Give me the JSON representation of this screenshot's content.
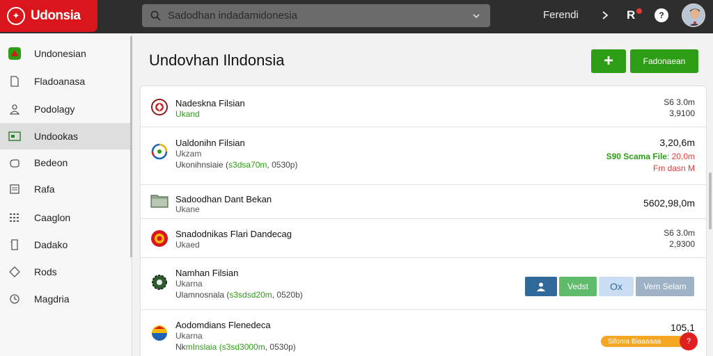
{
  "app": {
    "brand": "Udonsia",
    "search_placeholder": "Sadodhan indadamidonesia"
  },
  "topbar": {
    "link_label": "Ferendi",
    "notif_label": "R",
    "help_label": "?"
  },
  "sidebar": {
    "items": [
      {
        "label": "Undonesian",
        "icon": "app-logo-icon"
      },
      {
        "label": "Fladoanasa",
        "icon": "file-icon"
      },
      {
        "label": "Podolagy",
        "icon": "user-icon"
      },
      {
        "label": "Undookas",
        "icon": "card-icon",
        "active": true
      },
      {
        "label": "Bedeon",
        "icon": "hand-icon"
      },
      {
        "label": "Rafa",
        "icon": "document-icon"
      },
      {
        "label": "Caaglon",
        "icon": "grid-icon"
      },
      {
        "label": "Dadako",
        "icon": "page-icon"
      },
      {
        "label": "Rods",
        "icon": "diamond-icon"
      },
      {
        "label": "Magdria",
        "icon": "clock-icon"
      }
    ]
  },
  "main": {
    "title": "Undovhan Ilndonsia",
    "add_label": "+",
    "primary_label": "Fadonaean"
  },
  "rows": [
    {
      "title": "Nadeskna Filsian",
      "subtitle": "Ukand",
      "right_top": "S6 3.0m",
      "right_bottom": "3,9100"
    },
    {
      "title": "Ualdonihn Filsian",
      "subtitle": "Ukzam",
      "meta_prefix": "Ukonihnsiaie (",
      "meta_highlight": "s3dsa70m",
      "meta_suffix": ", 0530p)",
      "right_top": "3,20,6m",
      "right_status_green": "S90 Scama File",
      "right_status_red_inline": ": 20,0m",
      "right_status_red": "Fm dasn M"
    },
    {
      "title": "Sadoodhan Dant Bekan",
      "subtitle": "Ukane",
      "right_top": "5602,98,0m"
    },
    {
      "title": "Snadodnikas Flari Dandecag",
      "subtitle": "Ukaed",
      "right_top": "S6 3.0m",
      "right_bottom": "2,9300"
    },
    {
      "title": "Namhan Filsian",
      "subtitle": "Ukarna",
      "meta_prefix": "Ulamnosnala (",
      "meta_highlight": "s3sdsd20m",
      "meta_suffix": ", 0520b)",
      "actions": {
        "user_icon": "user-icon",
        "verify": "Vedst",
        "ok": "Ox",
        "view": "Vem Selam"
      }
    },
    {
      "title": "Aodomdians Flenedeca",
      "subtitle": "Ukarna",
      "meta_prefix": "Nk",
      "meta_highlight": "mInslaia (s3sd3000m",
      "meta_suffix": ", 0530p)",
      "right_top": "105,1",
      "badge": "Sifoma Biaaaaaa",
      "fab": "?"
    }
  ],
  "colors": {
    "brand_red": "#d9161c",
    "accent_green": "#2e9d16",
    "topbar": "#2e2e2e",
    "action_blue": "#2f6a9a",
    "action_green": "#5fba6a",
    "action_light": "#c9def2",
    "action_gray": "#9eb2c6",
    "badge_orange": "#f5a623"
  }
}
